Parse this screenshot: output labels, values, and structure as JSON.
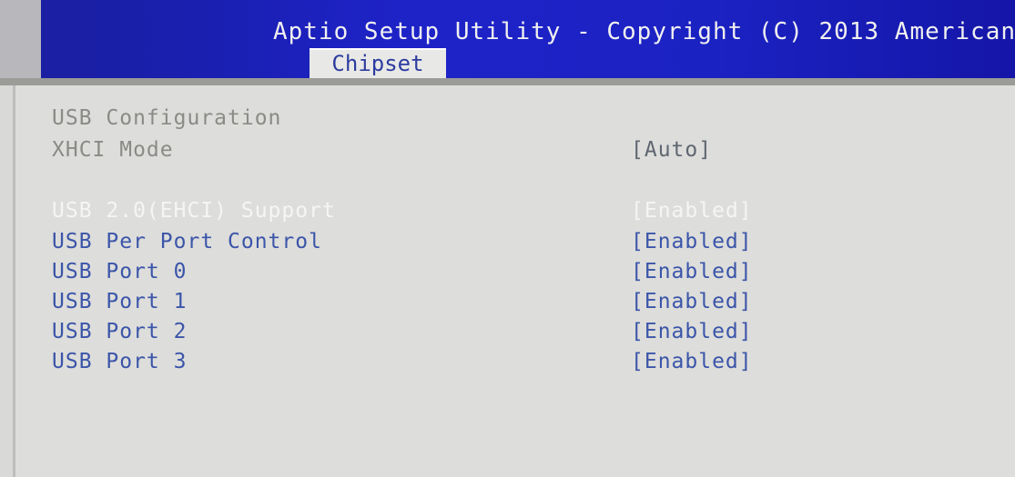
{
  "header": {
    "title": "Aptio Setup Utility - Copyright (C) 2013 American",
    "active_tab": "Chipset"
  },
  "section": {
    "heading": "USB Configuration"
  },
  "settings": [
    {
      "label": "XHCI Mode",
      "value": "[Auto]"
    },
    {
      "label": "USB 2.0(EHCI) Support",
      "value": "[Enabled]"
    },
    {
      "label": "USB Per Port Control",
      "value": "[Enabled]"
    },
    {
      "label": "USB Port 0",
      "value": "[Enabled]"
    },
    {
      "label": "USB Port 1",
      "value": "[Enabled]"
    },
    {
      "label": "USB Port 2",
      "value": "[Enabled]"
    },
    {
      "label": "USB Port 3",
      "value": "[Enabled]"
    }
  ],
  "colors": {
    "header_bg": "#1e23c8",
    "panel_bg": "#dddddb",
    "selected_text": "#f5f5f5",
    "option_text": "#3b55a9",
    "disabled_text": "#8a8a86"
  }
}
